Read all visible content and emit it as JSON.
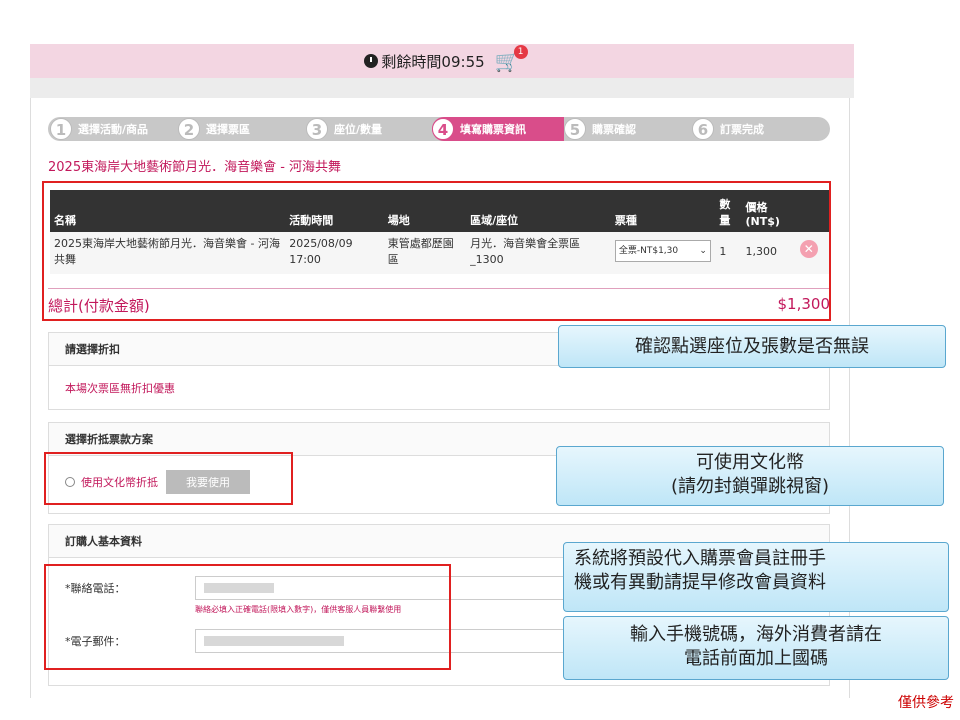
{
  "header": {
    "timer_text": "剩餘時間09:55",
    "cart_count": "1"
  },
  "steps": [
    {
      "num": "1",
      "label": "選擇活動/商品"
    },
    {
      "num": "2",
      "label": "選擇票區"
    },
    {
      "num": "3",
      "label": "座位/數量"
    },
    {
      "num": "4",
      "label": "填寫購票資訊"
    },
    {
      "num": "5",
      "label": "購票確認"
    },
    {
      "num": "6",
      "label": "訂票完成"
    }
  ],
  "event_title": "2025東海岸大地藝術節月光．海音樂會 - 河海共舞",
  "table": {
    "headers": [
      "名稱",
      "活動時間",
      "場地",
      "區域/座位",
      "票種",
      "數量",
      "價格(NT$)"
    ],
    "row": {
      "name": "2025東海岸大地藝術節月光．海音樂會 - 河海共舞",
      "time": "2025/08/09 17:00",
      "venue": "東管處都歷園區",
      "area": "月光．海音樂會全票區_1300",
      "ticket_type": "全票-NT$1,30",
      "qty": "1",
      "price": "1,300"
    }
  },
  "total": {
    "label": "總計(付款金額)",
    "amount": "$1,300"
  },
  "discount": {
    "title": "請選擇折扣",
    "text": "本場次票區無折扣優惠"
  },
  "voucher": {
    "title": "選擇折抵票款方案",
    "option": "使用文化幣折抵",
    "button": "我要使用"
  },
  "buyer": {
    "title": "訂購人基本資料",
    "phone_label": "*聯絡電話：",
    "phone_hint": "聯絡必填入正確電話(限填入數字)，僅供客服人員聯繫使用",
    "email_label": "*電子郵件："
  },
  "callouts": {
    "c1": "確認點選座位及張數是否無誤",
    "c2a": "可使用文化幣",
    "c2b": "(請勿封鎖彈跳視窗)",
    "c3a": "系統將預設代入購票會員註冊手",
    "c3b": "機或有異動請提早修改會員資料",
    "c4a": "輸入手機號碼，海外消費者請在",
    "c4b": "電話前面加上國碼"
  },
  "reference": "僅供參考",
  "colors": {
    "accent": "#d94d8a",
    "highlight": "#e02020",
    "callout_border": "#5aa7cf"
  }
}
